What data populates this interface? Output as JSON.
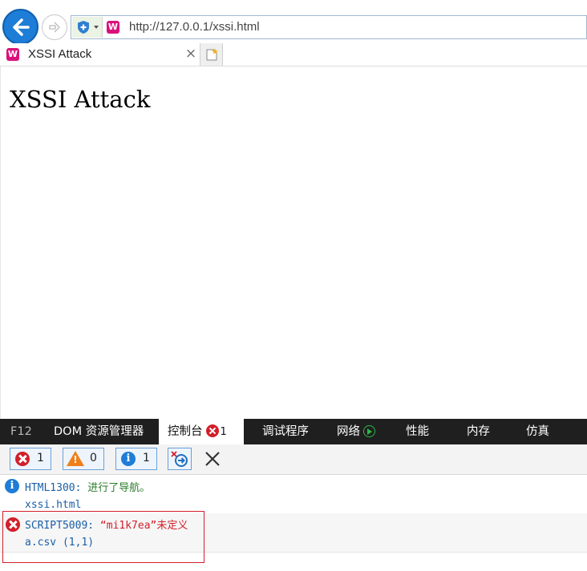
{
  "browser": {
    "url": "http://127.0.0.1/xssi.html",
    "site_icon_glyph": "W",
    "tab_title": "XSSI Attack",
    "tab_close_glyph": "×"
  },
  "page": {
    "heading": "XSSI Attack"
  },
  "devtools": {
    "tabs": [
      {
        "label": "F12"
      },
      {
        "label": "DOM 资源管理器"
      },
      {
        "label": "控制台",
        "badge_count": "1"
      },
      {
        "label": "调试程序"
      },
      {
        "label": "网络"
      },
      {
        "label": "性能"
      },
      {
        "label": "内存"
      },
      {
        "label": "仿真"
      }
    ],
    "filters": {
      "errors": "1",
      "warnings": "0",
      "info": "1"
    },
    "messages": [
      {
        "type": "info",
        "code": "HTML1300:",
        "text": "进行了导航。",
        "source": "xssi.html"
      },
      {
        "type": "error",
        "code": "SCRIPT5009:",
        "text": "“mi1k7ea”未定义",
        "source": "a.csv (1,1)"
      }
    ]
  },
  "colors": {
    "accent": "#1e7dd6",
    "error": "#d21f2a",
    "warning": "#ef7f1a",
    "devtools_bar": "#1f1f1f"
  }
}
